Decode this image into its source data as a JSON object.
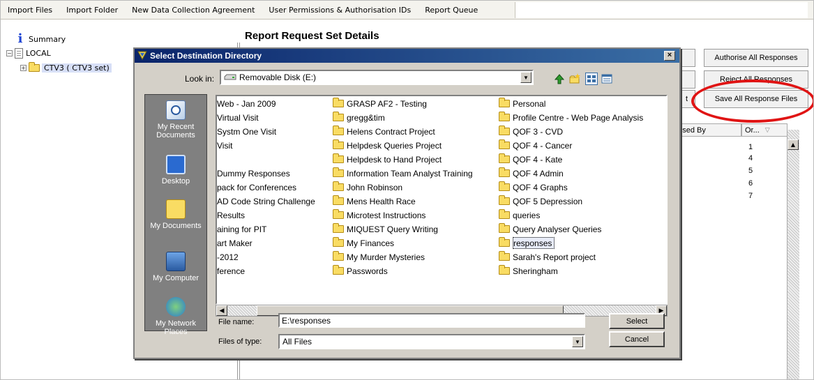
{
  "menu": {
    "items": [
      "Import Files",
      "Import Folder",
      "New Data Collection Agreement",
      "User Permissions & Authorisation IDs",
      "Report Queue"
    ]
  },
  "tree": {
    "summary": "Summary",
    "local": "LOCAL",
    "ctv3": "CTV3 ( CTV3 set)"
  },
  "report": {
    "title": "Report Request Set Details",
    "buttons": {
      "authorise_all": "Authorise All Responses",
      "reject_all": "Reject All Responses",
      "save_all": "Save All Response Files",
      "partial": "t"
    },
    "columns": {
      "authorised_by": "orised By",
      "order": "Or...",
      "order_sort_icon": "sort-down-icon"
    },
    "order_values": [
      "1",
      "4",
      "5",
      "6",
      "7"
    ]
  },
  "dialog": {
    "title": "Select Destination Directory",
    "look_in_label": "Look in:",
    "look_in_value": "Removable Disk (E:)",
    "places": [
      "My Recent Documents",
      "Desktop",
      "My Documents",
      "My Computer",
      "My Network Places"
    ],
    "files_col1": [
      "Web - Jan 2009",
      "Virtual Visit",
      "Systm One Visit",
      "Visit",
      "",
      "Dummy Responses",
      "pack for Conferences",
      "AD Code String Challenge",
      "Results",
      "aining for PIT",
      "art Maker",
      "-2012",
      "ference"
    ],
    "files_col2": [
      "GRASP AF2 - Testing",
      "gregg&tim",
      "Helens Contract Project",
      "Helpdesk Queries Project",
      "Helpdesk to Hand Project",
      "Information Team Analyst Training",
      "John Robinson",
      "Mens Health Race",
      "Microtest Instructions",
      "MIQUEST Query Writing",
      "My Finances",
      "My Murder Mysteries",
      "Passwords"
    ],
    "files_col3": [
      "Personal",
      "Profile Centre - Web Page Analysis",
      "QOF 3 - CVD",
      "QOF 4 - Cancer",
      "QOF 4 - Kate",
      "QOF 4 Admin",
      "QOF 4 Graphs",
      "QOF 5 Depression",
      "queries",
      "Query Analyser Queries",
      "responses",
      "Sarah's Report project",
      "Sheringham"
    ],
    "selected_file": "responses",
    "file_name_label": "File name:",
    "file_name_value": "E:\\responses",
    "file_type_label": "Files of type:",
    "file_type_value": "All Files",
    "select_button": "Select",
    "cancel_button": "Cancel"
  },
  "colors": {
    "highlight_oval": "#e01414",
    "title_bar": "#0a246a",
    "folder": "#f9dc63"
  }
}
